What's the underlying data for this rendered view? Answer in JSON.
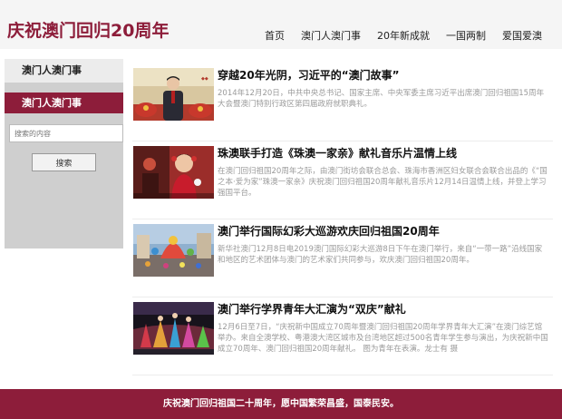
{
  "site": {
    "title": "庆祝澳门回归20周年"
  },
  "nav": {
    "items": [
      "首页",
      "澳门人澳门事",
      "20年新成就",
      "一国两制",
      "爱国爱澳"
    ]
  },
  "sidebar": {
    "heading": "澳门人澳门事",
    "active_item": "澳门人澳门事",
    "search_placeholder": "搜索的内容",
    "search_button": "搜索"
  },
  "articles": [
    {
      "title": "穿越20年光阴，习近平的“澳门故事”",
      "summary": "2014年12月20日，中共中央总书记、国家主席、中央军委主席习近平出席澳门回归祖国15周年大会暨澳门特别行政区第四届政府就职典礼。",
      "thumb_icon": "portrait-photo-icon"
    },
    {
      "title": "珠澳联手打造《珠澳一家亲》献礼音乐片温情上线",
      "summary": "在澳门回归祖国20周年之际，由澳门街坊会联合总会、珠海市香洲区妇女联合会联合出品的《“国之本·爱为家”珠澳一家亲》庆祝澳门回归祖国20周年献礼音乐片12月14日温情上线，并登上学习强国平台。",
      "thumb_icon": "girl-photo-icon"
    },
    {
      "title": "澳门举行国际幻彩大巡游欢庆回归祖国20周年",
      "summary": "新华社澳门12月8日电2019澳门国际幻彩大巡游8日下午在澳门举行，来自“一带一路”沿线国家和地区的艺术团体与澳门的艺术家们共同参与，欢庆澳门回归祖国20周年。",
      "thumb_icon": "parade-photo-icon"
    },
    {
      "title": "澳门举行学界青年大汇演为“双庆”献礼",
      "summary": "12月6日至7日，“庆祝新中国成立70周年暨澳门回归祖国20周年学界青年大汇演”在澳门综艺馆举办。来自全澳学校、粤港澳大湾区城市及台湾地区超过500名青年学生参与演出，为庆祝新中国成立70周年、澳门回归祖国20周年献礼。 图为青年在表演。龙士有 摄",
      "thumb_icon": "performance-photo-icon"
    }
  ],
  "footer": {
    "text": "庆祝澳门回归祖国二十周年，愿中国繁荣昌盛，国泰民安。"
  },
  "colors": {
    "brand": "#8d1d3a",
    "header_bg": "#f5f5f5",
    "sidebar_bg": "#cfcfcf",
    "summary_text": "#9a9a9a"
  }
}
